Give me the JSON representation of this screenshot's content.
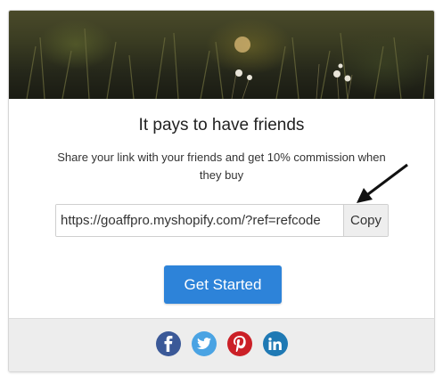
{
  "card": {
    "headline": "It pays to have friends",
    "subtext": "Share your link with your friends and get 10% commission when they buy",
    "referral_link": "https://goaffpro.myshopify.com/?ref=refcode",
    "copy_label": "Copy",
    "cta_label": "Get Started"
  },
  "social": [
    {
      "name": "facebook",
      "icon": "facebook-icon",
      "color": "#3b5998"
    },
    {
      "name": "twitter",
      "icon": "twitter-icon",
      "color": "#4aa3e3"
    },
    {
      "name": "pinterest",
      "icon": "pinterest-icon",
      "color": "#cb2027"
    },
    {
      "name": "linkedin",
      "icon": "linkedin-icon",
      "color": "#1f79b4"
    }
  ],
  "colors": {
    "accent": "#2d83d9",
    "footer_bg": "#ededed"
  }
}
